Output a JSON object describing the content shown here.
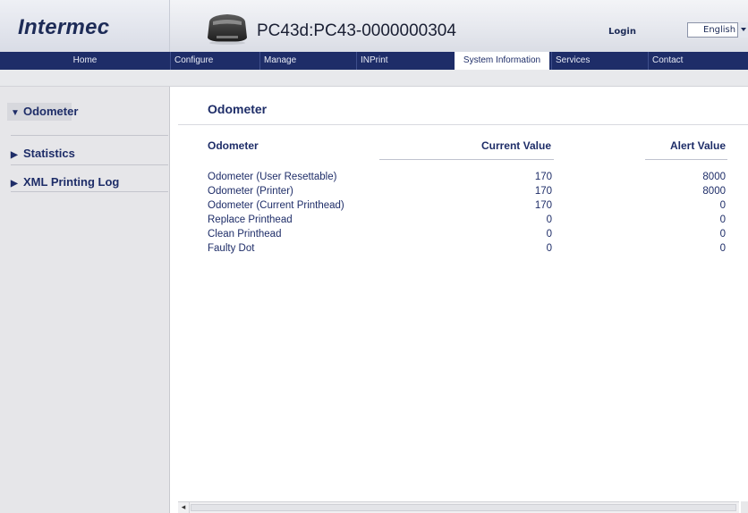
{
  "header": {
    "logo_text": "Intermec",
    "device_title": "PC43d:PC43-0000000304",
    "login_label": "Login",
    "language": "English"
  },
  "nav": {
    "items": [
      "Home",
      "Configure",
      "Manage",
      "INPrint",
      "System Information",
      "Services",
      "Contact"
    ],
    "active": "System Information"
  },
  "sidebar": {
    "items": [
      {
        "label": "Odometer",
        "expanded": true
      },
      {
        "label": "Statistics",
        "expanded": false
      },
      {
        "label": "XML Printing Log",
        "expanded": false
      }
    ]
  },
  "main": {
    "title": "Odometer",
    "table": {
      "headers": [
        "Odometer",
        "Current Value",
        "Alert Value"
      ],
      "rows": [
        {
          "name": "Odometer (User Resettable)",
          "current": "170",
          "alert": "8000"
        },
        {
          "name": "Odometer (Printer)",
          "current": "170",
          "alert": "8000"
        },
        {
          "name": "Odometer (Current Printhead)",
          "current": "170",
          "alert": "0"
        },
        {
          "name": "Replace Printhead",
          "current": "0",
          "alert": "0"
        },
        {
          "name": "Clean Printhead",
          "current": "0",
          "alert": "0"
        },
        {
          "name": "Faulty Dot",
          "current": "0",
          "alert": "0"
        }
      ]
    }
  },
  "colors": {
    "brand_navy": "#1e2d68",
    "nav_text": "#e8ebf5",
    "sidebar_bg": "#e6e6e9"
  },
  "icons": {
    "printer": "printer-icon",
    "expanded": "triangle-down-icon",
    "collapsed": "triangle-right-icon",
    "dropdown": "chevron-down-icon"
  }
}
